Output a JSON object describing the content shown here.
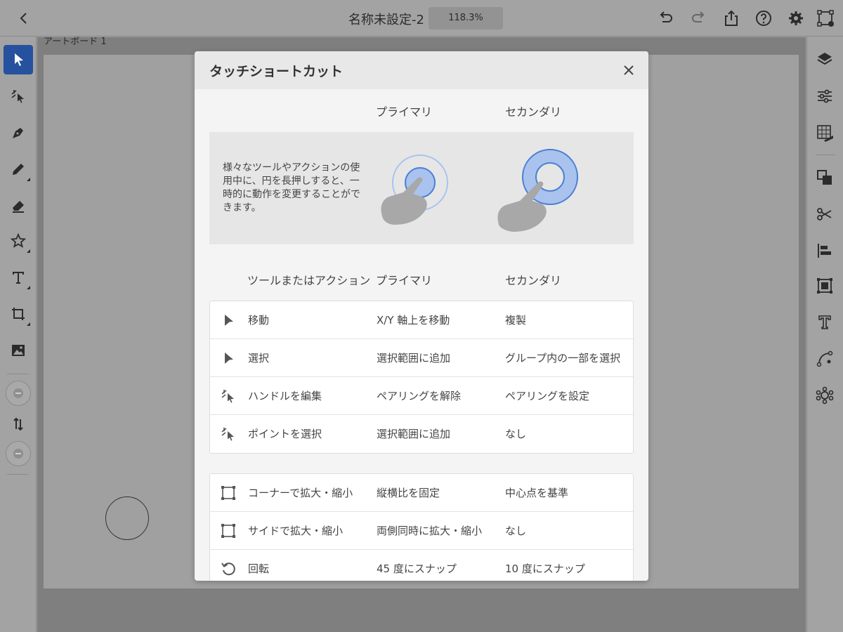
{
  "topbar": {
    "doc_title": "名称未設定-2",
    "zoom": "118.3%"
  },
  "canvas": {
    "artboard_label": "アートボード 1"
  },
  "modal": {
    "title": "タッチショートカット",
    "header_primary": "プライマリ",
    "header_secondary": "セカンダリ",
    "demo_text": "様々なツールやアクションの使用中に、円を長押しすると、一時的に動作を変更することができます。",
    "table_headers": {
      "tool": "ツールまたはアクション",
      "primary": "プライマリ",
      "secondary": "セカンダリ"
    },
    "group1": [
      {
        "icon": "arrow-cursor-icon",
        "tool": "移動",
        "primary": "X/Y 軸上を移動",
        "secondary": "複製"
      },
      {
        "icon": "arrow-cursor-icon",
        "tool": "選択",
        "primary": "選択範囲に追加",
        "secondary": "グループ内の一部を選択"
      },
      {
        "icon": "direct-select-icon",
        "tool": "ハンドルを編集",
        "primary": "ペアリングを解除",
        "secondary": "ペアリングを設定"
      },
      {
        "icon": "direct-select-icon",
        "tool": "ポイントを選択",
        "primary": "選択範囲に追加",
        "secondary": "なし"
      }
    ],
    "group2": [
      {
        "icon": "bounding-box-icon",
        "tool": "コーナーで拡大・縮小",
        "primary": "縦横比を固定",
        "secondary": "中心点を基準"
      },
      {
        "icon": "bounding-box-icon",
        "tool": "サイドで拡大・縮小",
        "primary": "両側同時に拡大・縮小",
        "secondary": "なし"
      },
      {
        "icon": "rotate-icon",
        "tool": "回転",
        "primary": "45 度にスナップ",
        "secondary": "10 度にスナップ"
      }
    ]
  },
  "colors": {
    "accent": "#26519e",
    "ring_blue": "#4a7fd4",
    "ring_light": "#a9c3ee"
  }
}
